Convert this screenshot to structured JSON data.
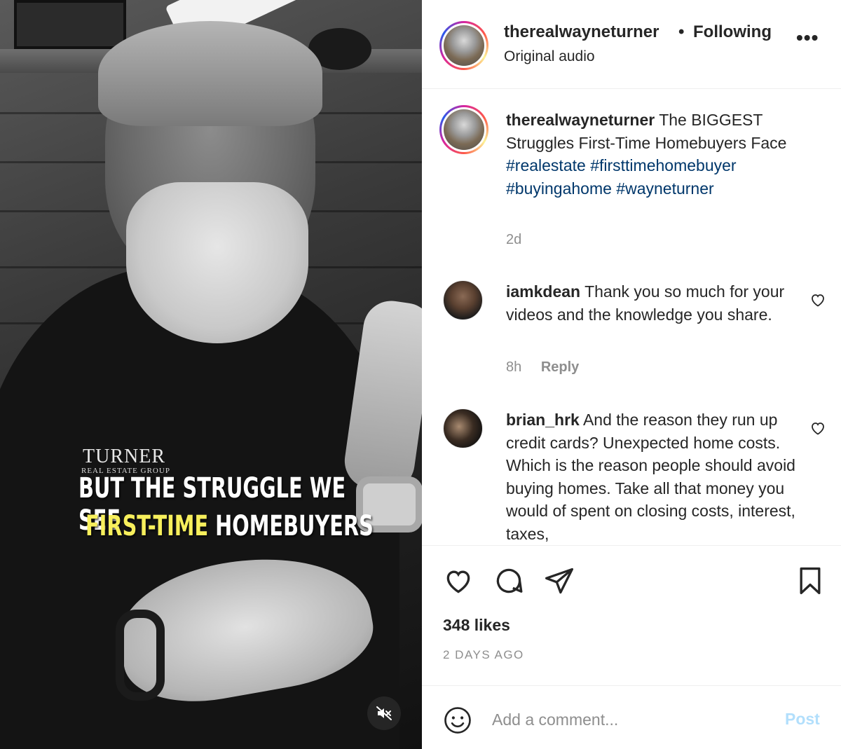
{
  "video": {
    "logo_text": "TURNER",
    "logo_subtext": "REAL ESTATE GROUP",
    "caption_line1": "BUT THE STRUGGLE WE SEE",
    "caption_line2_highlight": "FIRST-TIME",
    "caption_line2_rest": "HOMEBUYERS",
    "highlight_color": "#f7ef5c",
    "mute_icon": "speaker-muted-icon"
  },
  "header": {
    "username": "therealwayneturner",
    "separator": "•",
    "follow_status": "Following",
    "audio": "Original audio",
    "more_label": "•••"
  },
  "caption": {
    "username": "therealwayneturner",
    "text": "The BIGGEST Struggles First-Time Homebuyers Face",
    "hashtags": [
      "#realestate",
      "#firsttimehomebuyer",
      "#buyingahome",
      "#wayneturner"
    ],
    "time": "2d"
  },
  "comments": [
    {
      "username": "iamkdean",
      "text": "Thank you so much for your videos and the knowledge you share.",
      "time": "8h",
      "reply_label": "Reply"
    },
    {
      "username": "brian_hrk",
      "text": "And the reason they run up credit cards? Unexpected home costs. Which is the reason people should avoid buying homes. Take all that money you would of spent on closing costs, interest, taxes,"
    }
  ],
  "actions": {
    "like_icon": "heart-icon",
    "comment_icon": "comment-bubble-icon",
    "share_icon": "paper-plane-icon",
    "save_icon": "bookmark-icon"
  },
  "likes": "348 likes",
  "post_date": "2 DAYS AGO",
  "composer": {
    "placeholder": "Add a comment...",
    "post_label": "Post",
    "emoji_icon": "smiley-face-icon"
  },
  "colors": {
    "link": "#00376b",
    "muted": "#8e8e8e",
    "post_disabled": "#b2dffc",
    "text": "#262626"
  }
}
